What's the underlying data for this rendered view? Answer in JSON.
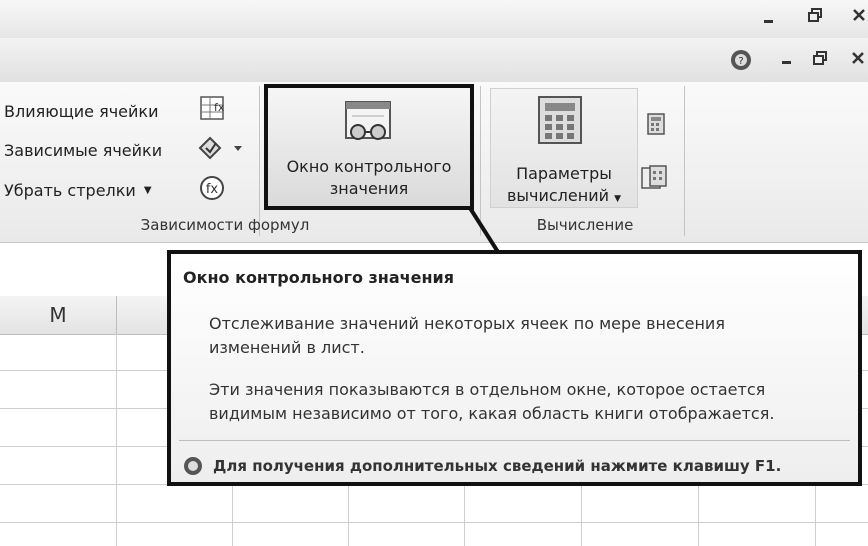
{
  "ribbon": {
    "audit_items": [
      {
        "label": "Влияющие ячейки",
        "icon": "trace-precedents-icon"
      },
      {
        "label": "Зависимые ячейки",
        "icon": "trace-dependents-icon"
      },
      {
        "label": "Убрать стрелки",
        "icon": "remove-arrows-icon"
      }
    ],
    "watch_window": {
      "line1": "Окно контрольного",
      "line2": "значения"
    },
    "group_formula_deps": "Зависимости формул",
    "calc_options": {
      "line1": "Параметры",
      "line2": "вычислений"
    },
    "group_calc": "Вычисление"
  },
  "sheet": {
    "column_m": "M"
  },
  "tooltip": {
    "title": "Окно контрольного значения",
    "para1_line1": "Отслеживание значений некоторых ячеек по мере внесения",
    "para1_line2": "изменений в лист.",
    "para2_line1": "Эти значения показываются в отдельном окне, которое остается",
    "para2_line2": "видимым независимо от того, какая область книги отображается.",
    "help": "Для получения дополнительных сведений нажмите клавишу F1."
  },
  "colors": {
    "highlight_border": "#111111",
    "ribbon_bg": "#ececec"
  }
}
